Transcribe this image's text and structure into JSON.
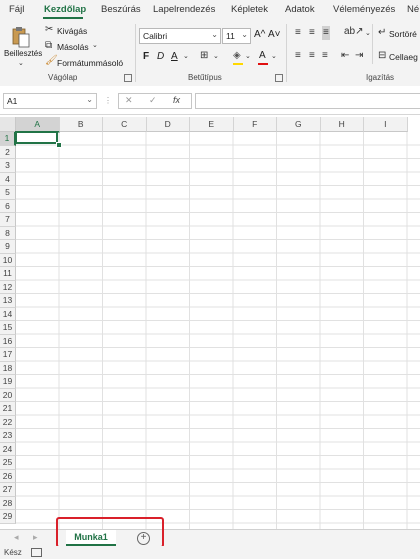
{
  "ribbon_tabs": [
    "Fájl",
    "Kezdőlap",
    "Beszúrás",
    "Lapelrendezés",
    "Képletek",
    "Adatok",
    "Véleményezés",
    "Né"
  ],
  "active_tab": "Kezdőlap",
  "clipboard": {
    "paste_label": "Beillesztés",
    "cut_label": "Kivágás",
    "copy_label": "Másolás",
    "format_painter_label": "Formátummásoló",
    "group_label": "Vágólap"
  },
  "font": {
    "font_name": "Calibri",
    "font_size": "11",
    "bold": "F",
    "italic": "D",
    "underline": "A",
    "grow": "A^",
    "shrink": "A˅",
    "font_color_letter": "A",
    "group_label": "Betűtípus"
  },
  "alignment": {
    "group_label": "Igazítás",
    "sort_label": "Sortöré",
    "merge_label": "Cellaeg"
  },
  "formula_bar": {
    "name_box": "A1",
    "fx": "fx",
    "formula": ""
  },
  "columns": [
    "A",
    "B",
    "C",
    "D",
    "E",
    "F",
    "G",
    "H",
    "I"
  ],
  "rows": [
    "1",
    "2",
    "3",
    "4",
    "5",
    "6",
    "7",
    "8",
    "9",
    "10",
    "11",
    "12",
    "13",
    "14",
    "15",
    "16",
    "17",
    "18",
    "19",
    "20",
    "21",
    "22",
    "23",
    "24",
    "25",
    "26",
    "27",
    "28",
    "29"
  ],
  "active_cell": "A1",
  "sheets": [
    "Munka1"
  ],
  "status": "Kész",
  "colors": {
    "accent": "#217346",
    "highlight": "#d9202a"
  }
}
